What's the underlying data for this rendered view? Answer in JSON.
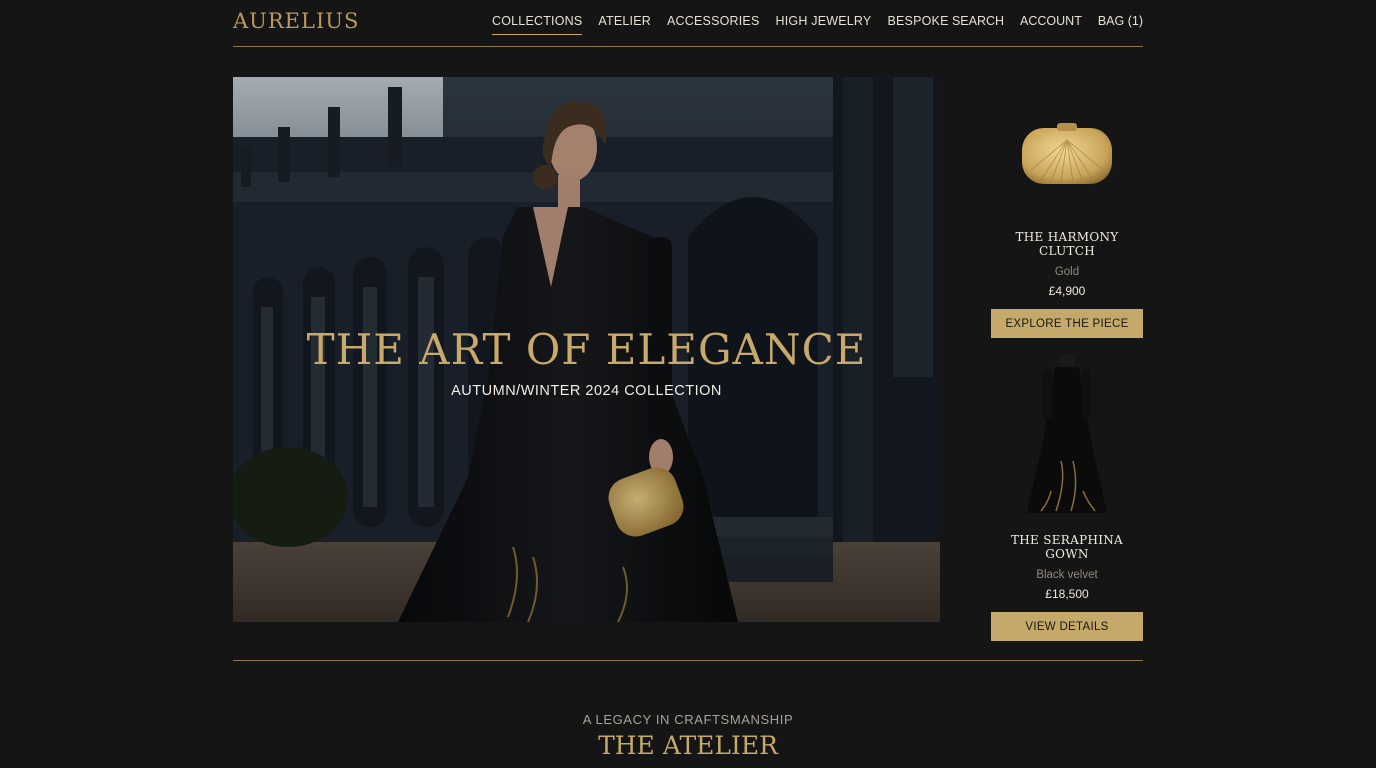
{
  "brand": {
    "logo": "AURELIUS"
  },
  "nav": {
    "items": [
      "COLLECTIONS",
      "ATELIER",
      "ACCESSORIES",
      "HIGH JEWELRY",
      "BESPOKE"
    ],
    "active": "COLLECTIONS"
  },
  "utility": {
    "search": "SEARCH",
    "account": "ACCOUNT",
    "bag": "BAG (1)"
  },
  "hero": {
    "title": "THE ART OF ELEGANCE",
    "subtitle": "AUTUMN/WINTER 2024 COLLECTION"
  },
  "products": [
    {
      "name": "THE HARMONY CLUTCH",
      "variant": "Gold",
      "price": "£4,900",
      "cta": "EXPLORE THE PIECE"
    },
    {
      "name": "THE SERAPHINA GOWN",
      "variant": "Black velvet",
      "price": "£18,500",
      "cta": "VIEW DETAILS"
    }
  ],
  "atelier": {
    "eyebrow": "A LEGACY IN CRAFTSMANSHIP",
    "title": "THE ATELIER"
  },
  "colors": {
    "gold": "#c4a96a",
    "background": "#151515",
    "divider": "#8a7448"
  }
}
